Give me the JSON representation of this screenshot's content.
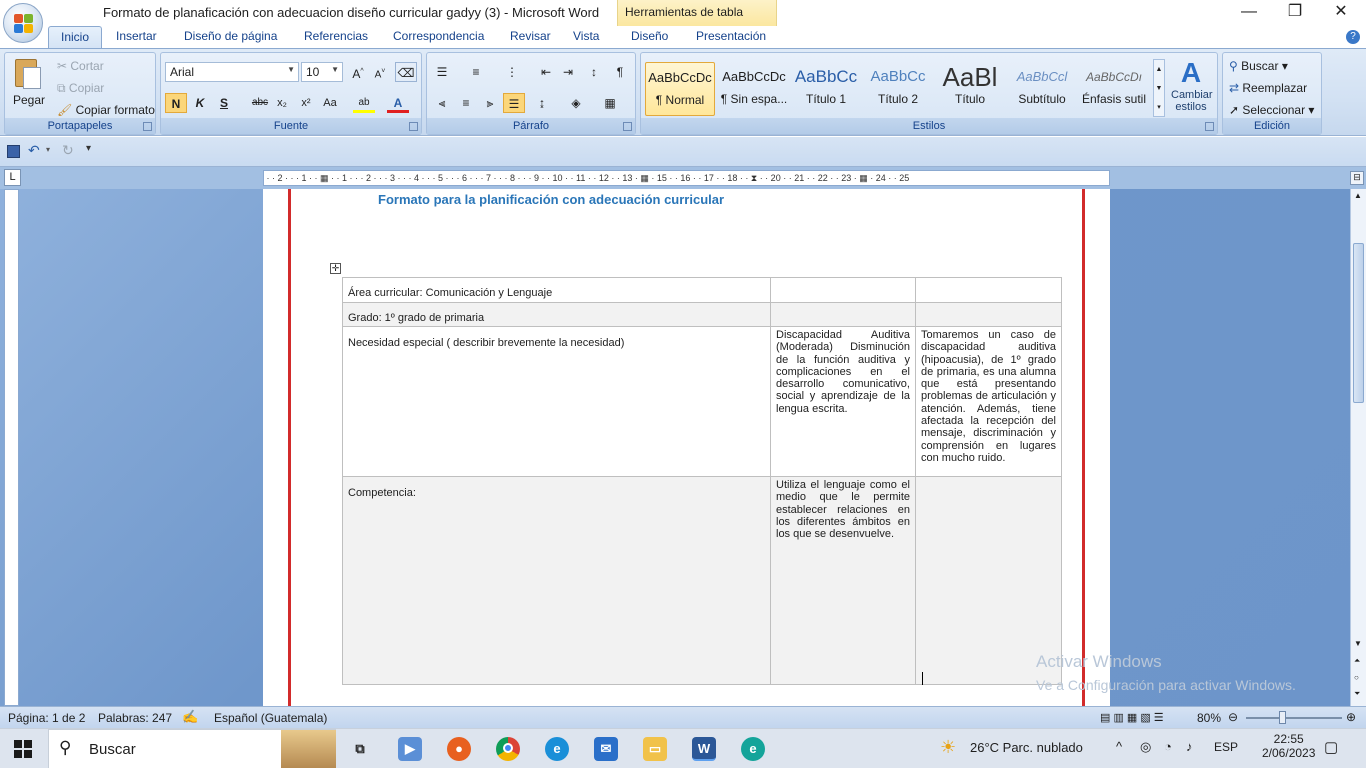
{
  "window": {
    "title": "Formato de planaficación con adecuacion diseño curricular gadyy (3) - Microsoft Word",
    "context_tab": "Herramientas de tabla",
    "minimize": "—",
    "restore": "❐",
    "close": "✕"
  },
  "tabs": [
    "Inicio",
    "Insertar",
    "Diseño de página",
    "Referencias",
    "Correspondencia",
    "Revisar",
    "Vista",
    "Diseño",
    "Presentación"
  ],
  "ribbon": {
    "clipboard": {
      "label": "Portapapeles",
      "paste": "Pegar",
      "cut": "Cortar",
      "copy": "Copiar",
      "format_painter": "Copiar formato"
    },
    "font": {
      "label": "Fuente",
      "family": "Arial",
      "size": "10"
    },
    "paragraph": {
      "label": "Párrafo"
    },
    "styles": {
      "label": "Estilos",
      "items": [
        {
          "sample": "AaBbCcDc",
          "name": "¶ Normal"
        },
        {
          "sample": "AaBbCcDc",
          "name": "¶ Sin espa..."
        },
        {
          "sample": "AaBbCc",
          "name": "Título 1"
        },
        {
          "sample": "AaBbCc",
          "name": "Título 2"
        },
        {
          "sample": "AaBl",
          "name": "Título"
        },
        {
          "sample": "AaBbCcl",
          "name": "Subtítulo"
        },
        {
          "sample": "AaBbCcDı",
          "name": "Énfasis sutil"
        }
      ],
      "change_styles": "Cambiar estilos"
    },
    "editing": {
      "label": "Edición",
      "find": "Buscar",
      "replace": "Reemplazar",
      "select": "Seleccionar"
    }
  },
  "document": {
    "heading": "Formato para la planificación con adecuación curricular",
    "table": {
      "row1": "Área curricular: Comunicación y Lenguaje",
      "row2": "Grado: 1º grado de primaria",
      "row3_label": "Necesidad especial ( describir brevemente  la necesidad)",
      "row3_col2": "Discapacidad Auditiva (Moderada) Disminución de la función auditiva y complicaciones en el desarrollo comunicativo, social y aprendizaje de la lengua escrita.",
      "row3_col3": "Tomaremos un caso de discapacidad auditiva (hipoacusia), de 1º grado de primaria, es una alumna que está presentando problemas de articulación y atención. Además, tiene afectada la recepción del mensaje, discriminación y comprensión en lugares con mucho ruido.",
      "row4_label": "Competencia:",
      "row4_col2": "Utiliza el lenguaje como el medio que le permite establecer relaciones en los diferentes ámbitos en los que se desenvuelve."
    }
  },
  "watermark": {
    "line1": "Activar Windows",
    "line2": "Ve a Configuración para activar Windows."
  },
  "statusbar": {
    "page": "Página: 1 de 2",
    "words": "Palabras: 247",
    "language": "Español (Guatemala)",
    "zoom": "80%"
  },
  "taskbar": {
    "search": "Buscar",
    "weather": "26°C  Parc. nublado",
    "lang": "ESP",
    "time": "22:55",
    "date": "2/06/2023"
  },
  "colors": {
    "heading": "#2a76b8",
    "margin_line": "#d22b2b",
    "ribbon_text": "#15428b"
  }
}
